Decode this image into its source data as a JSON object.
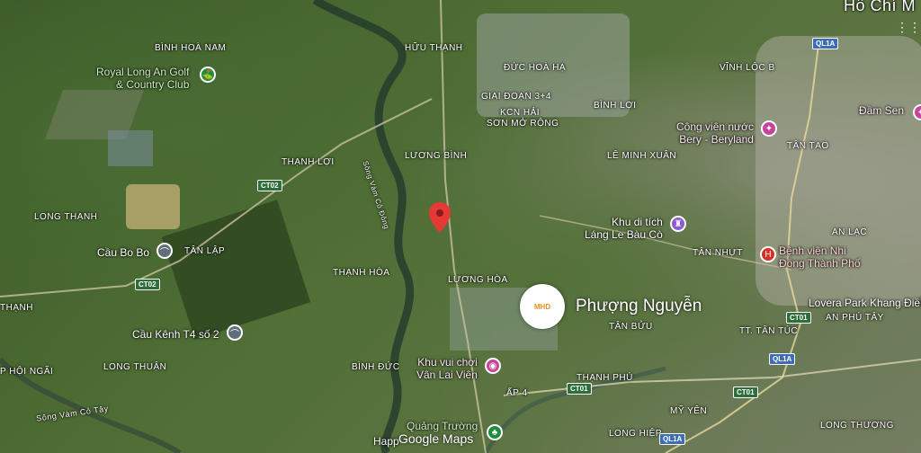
{
  "map": {
    "labels": [
      {
        "id": "binh-hoa-nam",
        "text": "BÌNH HOÀ NAM"
      },
      {
        "id": "huu-thanh",
        "text": "HỮU THẠNH"
      },
      {
        "id": "duc-hoa-ha",
        "text": "ĐỨC HOÀ HẠ"
      },
      {
        "id": "giai-doan",
        "text": "GIAI ĐOẠN 3+4"
      },
      {
        "id": "kcn-hai",
        "text": "KCN HẢI"
      },
      {
        "id": "son-mo-rong",
        "text": "SƠN MỞ RỘNG"
      },
      {
        "id": "binh-loi",
        "text": "BÌNH LỢI"
      },
      {
        "id": "vinh-loc-b",
        "text": "VĨNH LỘC B"
      },
      {
        "id": "luong-binh",
        "text": "LƯƠNG BÌNH"
      },
      {
        "id": "thanh-loi",
        "text": "THẠNH LỢI"
      },
      {
        "id": "le-minh-xuan",
        "text": "LÊ MINH XUÂN"
      },
      {
        "id": "tan-tao",
        "text": "TÂN TẠO"
      },
      {
        "id": "long-thanh",
        "text": "LONG THẠNH"
      },
      {
        "id": "tan-lap",
        "text": "TÂN LẬP"
      },
      {
        "id": "thanh-hoa",
        "text": "THẠNH HÒA"
      },
      {
        "id": "luong-hoa",
        "text": "LƯƠNG HÒA"
      },
      {
        "id": "an-lac",
        "text": "AN LẠC"
      },
      {
        "id": "tan-nhut",
        "text": "TÂN NHỰT"
      },
      {
        "id": "thanh-left",
        "text": "THẠNH"
      },
      {
        "id": "an-phu-tay",
        "text": "AN PHÚ TÂY"
      },
      {
        "id": "tan-buu",
        "text": "TÂN BỬU"
      },
      {
        "id": "tt-tan-tuc",
        "text": "TT. TÂN TÚC"
      },
      {
        "id": "hoi-ngai",
        "text": "P HỘI NGÃI"
      },
      {
        "id": "long-thuan",
        "text": "LONG THUẬN"
      },
      {
        "id": "binh-duc",
        "text": "BÌNH ĐỨC"
      },
      {
        "id": "thanh-phu",
        "text": "THẠNH PHÚ"
      },
      {
        "id": "ap-4",
        "text": "ẤP 4"
      },
      {
        "id": "my-yen",
        "text": "MỸ YÊN"
      },
      {
        "id": "long-thuong",
        "text": "LONG THƯỢNG"
      },
      {
        "id": "long-hiep",
        "text": "LONG HIỆP"
      },
      {
        "id": "song-vam-co-dong",
        "text": "Sông Vàm Cỏ Đông"
      },
      {
        "id": "song-vam-co-tay",
        "text": "Sông Vàm Cỏ Tây"
      },
      {
        "id": "ho-chi",
        "text": "Hồ Chí M"
      }
    ],
    "places": [
      {
        "id": "royal-long-an",
        "line1": "Royal Long An Golf",
        "line2": "& Country Club",
        "color": "#1e8e3e",
        "icon": "golf-icon"
      },
      {
        "id": "cong-vien-nuoc",
        "line1": "Công viên nước",
        "line2": "Bery - Beryland",
        "color": "#c5459a",
        "icon": "attraction-icon"
      },
      {
        "id": "dam-sen",
        "line1": "Đầm Sen",
        "line2": "",
        "color": "#c5459a",
        "icon": "attraction-icon"
      },
      {
        "id": "khu-di-tich",
        "line1": "Khu di tích",
        "line2": "Láng Le Bàu Cò",
        "color": "#8c5ad2",
        "icon": "monument-icon"
      },
      {
        "id": "benh-vien",
        "line1": "Bệnh viện Nhi",
        "line2": "Đồng Thành Phố",
        "color": "#d93025",
        "icon": "hospital-icon"
      },
      {
        "id": "cau-bo-bo",
        "line1": "Cầu Bo Bo",
        "line2": "",
        "color": "#5f6f7a",
        "icon": "bridge-icon"
      },
      {
        "id": "cau-kenh",
        "line1": "Cầu Kênh T4 số 2",
        "line2": "",
        "color": "#5f6f7a",
        "icon": "bridge-icon"
      },
      {
        "id": "khu-vui-choi",
        "line1": "Khu vui chơi",
        "line2": "Vân Lai Viên",
        "color": "#c5459a",
        "icon": "camera-icon"
      },
      {
        "id": "quang-truong",
        "line1": "Quảng Trường",
        "line2": "",
        "color": "#1e8e3e",
        "icon": "tree-icon"
      },
      {
        "id": "lovera",
        "line1": "Lovera Park Khang Điền",
        "line2": "",
        "color": "#5f6f7a",
        "icon": ""
      }
    ],
    "roads": [
      {
        "id": "ql1a-top",
        "text": "QL1A",
        "style": "blue"
      },
      {
        "id": "ct02-a",
        "text": "CT02",
        "style": "green"
      },
      {
        "id": "ct02-b",
        "text": "CT02",
        "style": "green"
      },
      {
        "id": "ct01-a",
        "text": "CT01",
        "style": "green"
      },
      {
        "id": "ct01-b",
        "text": "CT01",
        "style": "green"
      },
      {
        "id": "ct01-c",
        "text": "CT01",
        "style": "green"
      },
      {
        "id": "ql1a-mid",
        "text": "QL1A",
        "style": "blue"
      },
      {
        "id": "ql1a-bot",
        "text": "QL1A",
        "style": "blue"
      }
    ],
    "brand": "Phượng Nguyễn",
    "brand_badge": "MHD",
    "happ_text": "Happ",
    "attribution": "Google Maps",
    "marker": {
      "color": "#e53935"
    }
  }
}
